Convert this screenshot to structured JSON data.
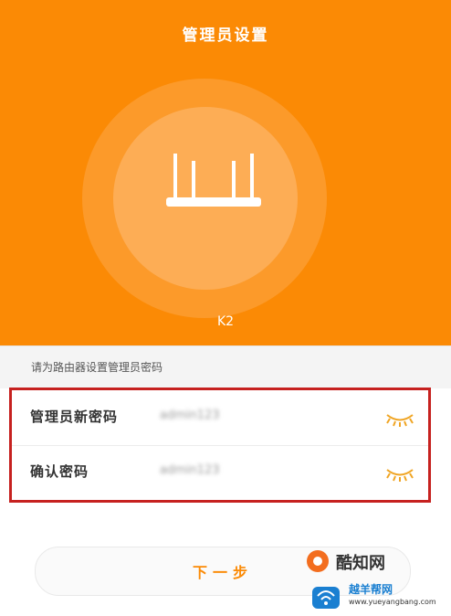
{
  "header": {
    "title": "管理员设置",
    "model": "K2"
  },
  "hint": {
    "text": "请为路由器设置管理员密码"
  },
  "form": {
    "rows": [
      {
        "label": "管理员新密码",
        "value": "admin123",
        "icon": "eye-lashes-icon"
      },
      {
        "label": "确认密码",
        "value": "admin123",
        "icon": "eye-lashes-icon"
      }
    ]
  },
  "actions": {
    "next_label": "下一步"
  },
  "watermarks": {
    "wm1_text": "酷知网",
    "wm2_title": "越羊帮网",
    "wm2_url": "www.yueyangbang.com"
  },
  "colors": {
    "primary": "#fb8a05",
    "highlight_border": "#c6211f"
  }
}
